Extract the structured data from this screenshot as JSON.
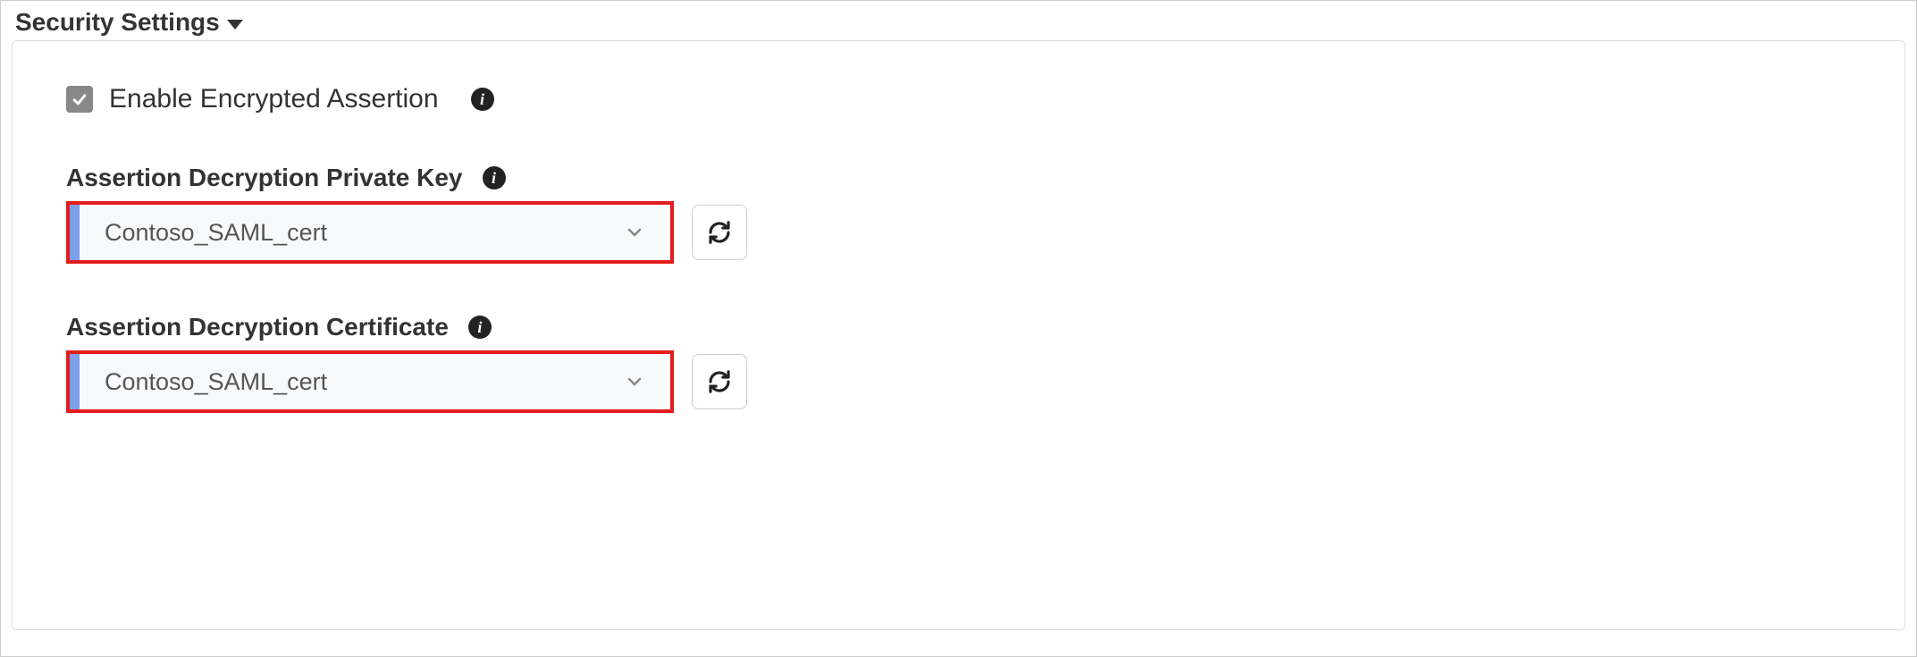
{
  "section": {
    "title": "Security Settings"
  },
  "enable_encrypted": {
    "label": "Enable Encrypted Assertion",
    "checked": true
  },
  "private_key": {
    "label": "Assertion Decryption Private Key",
    "value": "Contoso_SAML_cert"
  },
  "certificate": {
    "label": "Assertion Decryption Certificate",
    "value": "Contoso_SAML_cert"
  }
}
